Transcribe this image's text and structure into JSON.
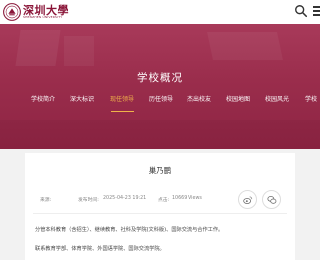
{
  "header": {
    "logo_text": "深圳大學",
    "logo_sub": "SHENZHEN UNIVERSITY"
  },
  "banner": {
    "title": "学校概况",
    "nav": [
      {
        "label": "学校简介",
        "active": false
      },
      {
        "label": "深大标识",
        "active": false
      },
      {
        "label": "现任领导",
        "active": true
      },
      {
        "label": "历任领导",
        "active": false
      },
      {
        "label": "杰出校友",
        "active": false
      },
      {
        "label": "校园地图",
        "active": false
      },
      {
        "label": "校园风光",
        "active": false
      },
      {
        "label": "学校",
        "active": false
      }
    ]
  },
  "article": {
    "title": "巢乃鹏",
    "source_label": "来源:",
    "date_label": "发布时间:",
    "date_value": "2025-04-23 19:21",
    "views_label": "点击:",
    "views_value": "10669",
    "views_unit": "Views",
    "paragraphs": [
      "分管本科教育（含招生）、继续教育、社科及学院(文科版)、国际交流与合作工作。",
      "联系教育学部、体育学院、外国语学院、国际交流学院。"
    ]
  },
  "colors": {
    "brand": "#8a1538",
    "banner": "#9a2d4c",
    "active_nav": "#f0b34a"
  },
  "icons": {
    "search": "search-icon",
    "menu": "menu-icon",
    "weibo": "weibo-icon",
    "wechat": "wechat-icon"
  }
}
